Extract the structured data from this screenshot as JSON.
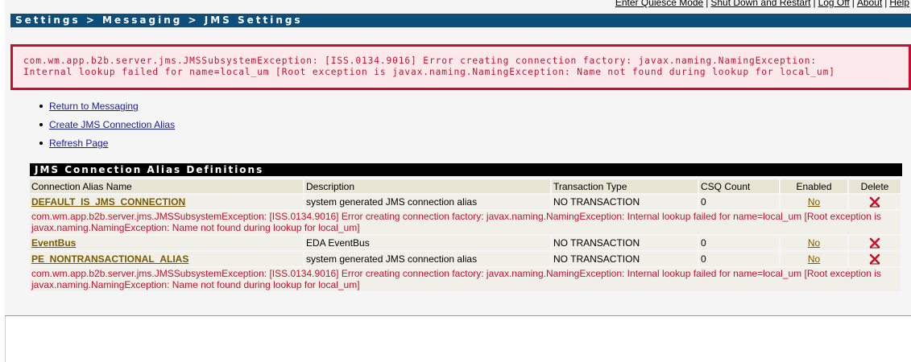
{
  "toplinks": {
    "items": [
      {
        "label": "Enter Quiesce Mode"
      },
      {
        "label": "Shut Down and Restart"
      },
      {
        "label": "Log Off"
      },
      {
        "label": "About"
      },
      {
        "label": "Help"
      }
    ],
    "separator": "|"
  },
  "breadcrumb": "Settings > Messaging > JMS Settings",
  "error_banner": {
    "line1": "com.wm.app.b2b.server.jms.JMSSubsystemException: [ISS.0134.9016] Error creating connection factory: javax.naming.NamingException:",
    "line2": "Internal lookup failed for name=local_um [Root exception is javax.naming.NamingException: Name not found during lookup for local_um]"
  },
  "nav_links": [
    {
      "label": "Return to Messaging"
    },
    {
      "label": "Create JMS Connection Alias"
    },
    {
      "label": "Refresh Page"
    }
  ],
  "table": {
    "title": "JMS Connection Alias Definitions",
    "headers": {
      "name": "Connection Alias Name",
      "description": "Description",
      "transaction": "Transaction Type",
      "csq": "CSQ Count",
      "enabled": "Enabled",
      "delete": "Delete"
    },
    "rows": [
      {
        "name": "DEFAULT_IS_JMS_CONNECTION",
        "description": "system generated JMS connection alias",
        "transaction": "NO TRANSACTION",
        "csq": "0",
        "enabled": "No",
        "error": "com.wm.app.b2b.server.jms.JMSSubsystemException: [ISS.0134.9016] Error creating connection factory: javax.naming.NamingException: Internal lookup failed for name=local_um [Root exception is javax.naming.NamingException: Name not found during lookup for local_um]"
      },
      {
        "name": "EventBus",
        "description": "EDA EventBus",
        "transaction": "NO TRANSACTION",
        "csq": "0",
        "enabled": "No"
      },
      {
        "name": "PE_NONTRANSACTIONAL_ALIAS",
        "description": "system generated JMS connection alias",
        "transaction": "NO TRANSACTION",
        "csq": "0",
        "enabled": "No",
        "error": "com.wm.app.b2b.server.jms.JMSSubsystemException: [ISS.0134.9016] Error creating connection factory: javax.naming.NamingException: Internal lookup failed for name=local_um [Root exception is javax.naming.NamingException: Name not found during lookup for local_um]"
      }
    ]
  },
  "icons": {
    "delete": "delete-x-icon",
    "bullet": "bullet-icon"
  },
  "colors": {
    "title_bar": "#0d4f7a",
    "error_red": "#c8102e",
    "link_blue": "#1a1a99",
    "alias_link": "#7a5a00"
  }
}
